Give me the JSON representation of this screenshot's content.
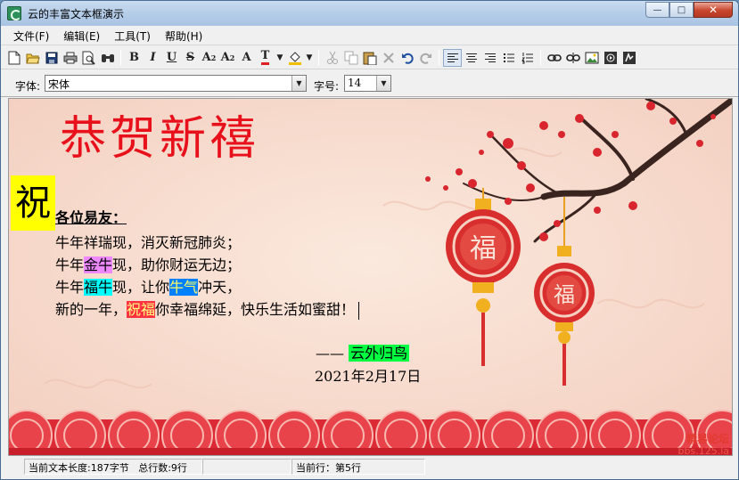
{
  "window": {
    "title": "云的丰富文本框演示",
    "minimize": "—",
    "maximize": "□",
    "close": "✕"
  },
  "menu": [
    {
      "label": "文件(F)"
    },
    {
      "label": "编辑(E)"
    },
    {
      "label": "工具(T)"
    },
    {
      "label": "帮助(H)"
    }
  ],
  "toolbar": {
    "bold": "B",
    "italic": "I",
    "underline": "U",
    "strike": "S",
    "superscript": "A",
    "superscript_mark": "2",
    "subscript": "A",
    "subscript_mark": "2",
    "font": "A",
    "text_color": "T",
    "dropdown": "▼"
  },
  "fontbar": {
    "font_label": "字体:",
    "font_value": "宋体",
    "size_label": "字号:",
    "size_value": "14"
  },
  "document": {
    "title": "恭贺新禧",
    "big_char": "祝",
    "salutation": "各位易友：",
    "lines": [
      {
        "pre": "牛年祥瑞现，消灭新冠肺炎；"
      },
      {
        "pre": "牛年",
        "hl": "金牛",
        "post": "现，助你财运无边；"
      },
      {
        "pre": "牛年",
        "hl": "福牛",
        "mid": "现，让你",
        "hl2": "牛气",
        "post": "冲天，"
      },
      {
        "pre": "新的一年，",
        "hl": "祝福",
        "post": "你幸福绵延，快乐生活如蜜甜！"
      }
    ],
    "sign_dash": "——",
    "signature": "云外归鸟",
    "date": "2021年2月17日",
    "lantern_char": "福"
  },
  "status": {
    "length": "当前文本长度:187字节",
    "lines": "总行数:9行",
    "current": "当前行：第5行"
  },
  "watermark": {
    "main": "精易论坛",
    "sub": "bbs.125.la"
  },
  "colors": {
    "title_red": "#e8101a",
    "highlight_yellow": "#ffff00",
    "highlight_green": "#00ff40"
  }
}
